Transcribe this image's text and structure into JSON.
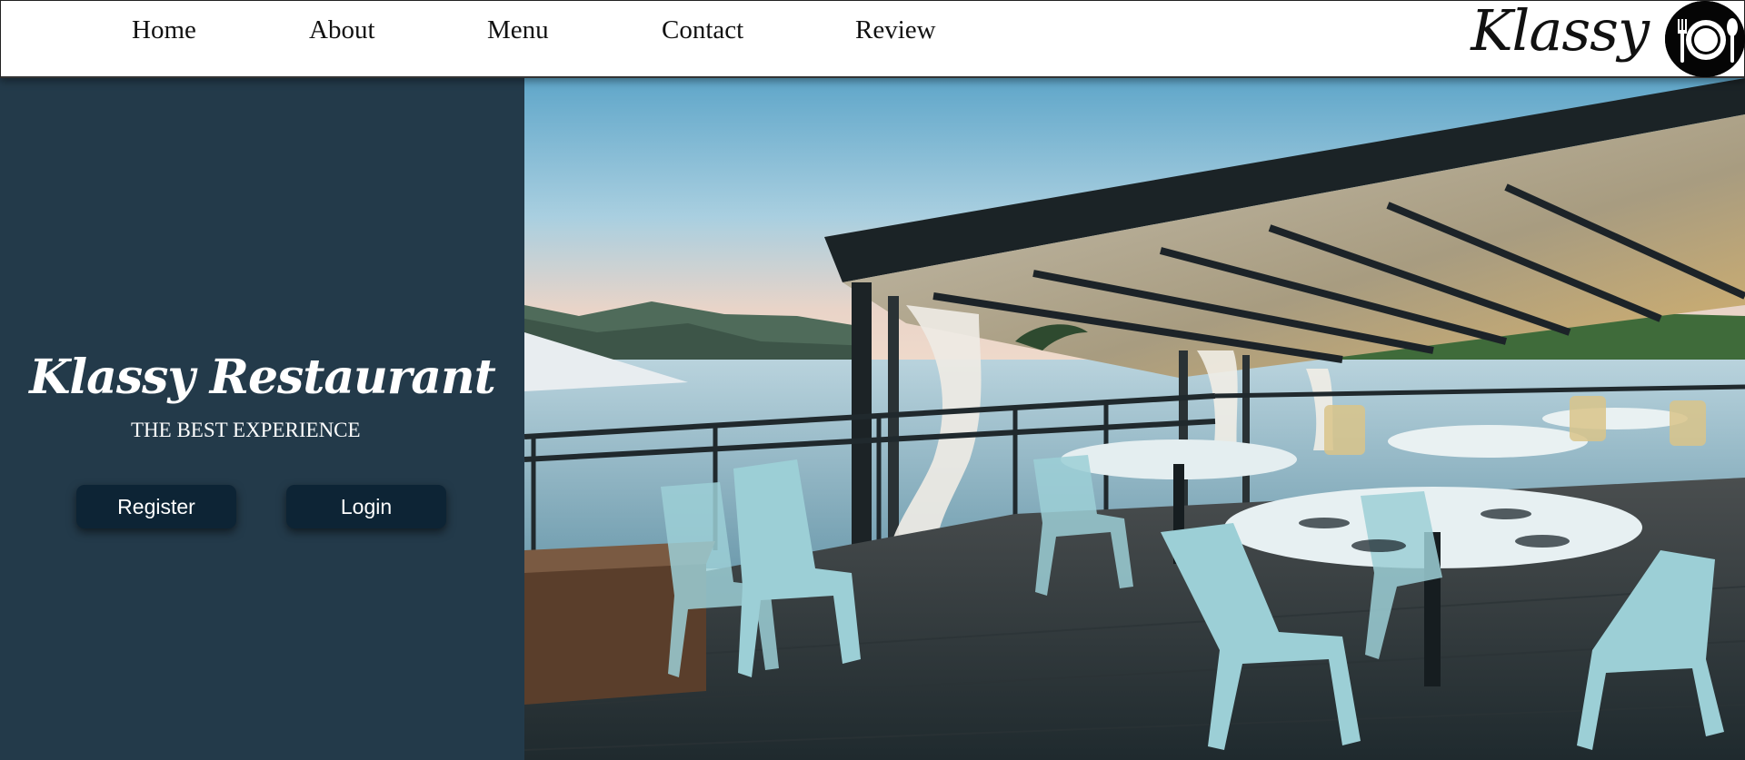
{
  "nav": {
    "items": [
      {
        "label": "Home"
      },
      {
        "label": "About"
      },
      {
        "label": "Menu"
      },
      {
        "label": "Contact"
      },
      {
        "label": "Review"
      }
    ],
    "brand": "Klassy",
    "logo_icon": "plate-fork-spoon-icon"
  },
  "hero": {
    "title": "Klassy Restaurant",
    "subtitle": "THE BEST EXPERIENCE",
    "register_label": "Register",
    "login_label": "Login",
    "image": "restaurant-terrace-photo"
  },
  "colors": {
    "panel": "#233a4a",
    "button": "#0d2435",
    "navbar": "#ffffff",
    "text_light": "#ffffff",
    "text_dark": "#111111"
  }
}
